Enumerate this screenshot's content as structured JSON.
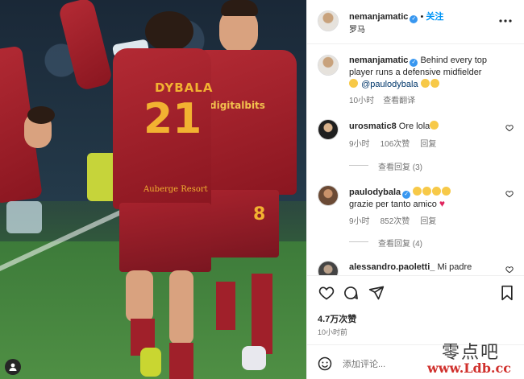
{
  "header": {
    "username": "nemanjamatic",
    "follow_label": "关注",
    "location": "罗马",
    "more_icon": "more-horizontal-icon"
  },
  "caption": {
    "username": "nemanjamatic",
    "text_line1": "Behind every top",
    "text_line2": "player runs a defensive midfielder",
    "mention": "@paulodybala",
    "time": "10小时",
    "translate": "查看翻译"
  },
  "comments": [
    {
      "username": "urosmatic8",
      "text": "Ore lola",
      "time": "9小时",
      "likes": "106次赞",
      "reply": "回复",
      "view_replies": "查看回复 (3)"
    },
    {
      "username": "paulodybala",
      "text": "grazie per tanto amico",
      "time": "9小时",
      "likes": "852次赞",
      "reply": "回复",
      "view_replies": "查看回复 (4)"
    },
    {
      "username": "alessandro.paoletti_",
      "text": "Mi padre"
    }
  ],
  "actions": {
    "like_icon": "heart-icon",
    "comment_icon": "comment-icon",
    "share_icon": "share-icon",
    "save_icon": "bookmark-icon",
    "likes_count": "4.7万次赞",
    "post_time": "10小时前"
  },
  "composer": {
    "placeholder": "添加评论...",
    "emoji_icon": "smiley-icon"
  },
  "photo": {
    "jersey_name": "DYBALA",
    "jersey_number": "21",
    "sponsor": "Auberge Resort",
    "teammate_sponsor": "digitalbits",
    "teammate_number": "8"
  },
  "watermark": {
    "cn": "零点吧",
    "url": "www.Ldb.cc"
  },
  "colors": {
    "accent": "#0095f6",
    "jersey": "#9e1f2a",
    "jersey_text": "#f2b231"
  }
}
